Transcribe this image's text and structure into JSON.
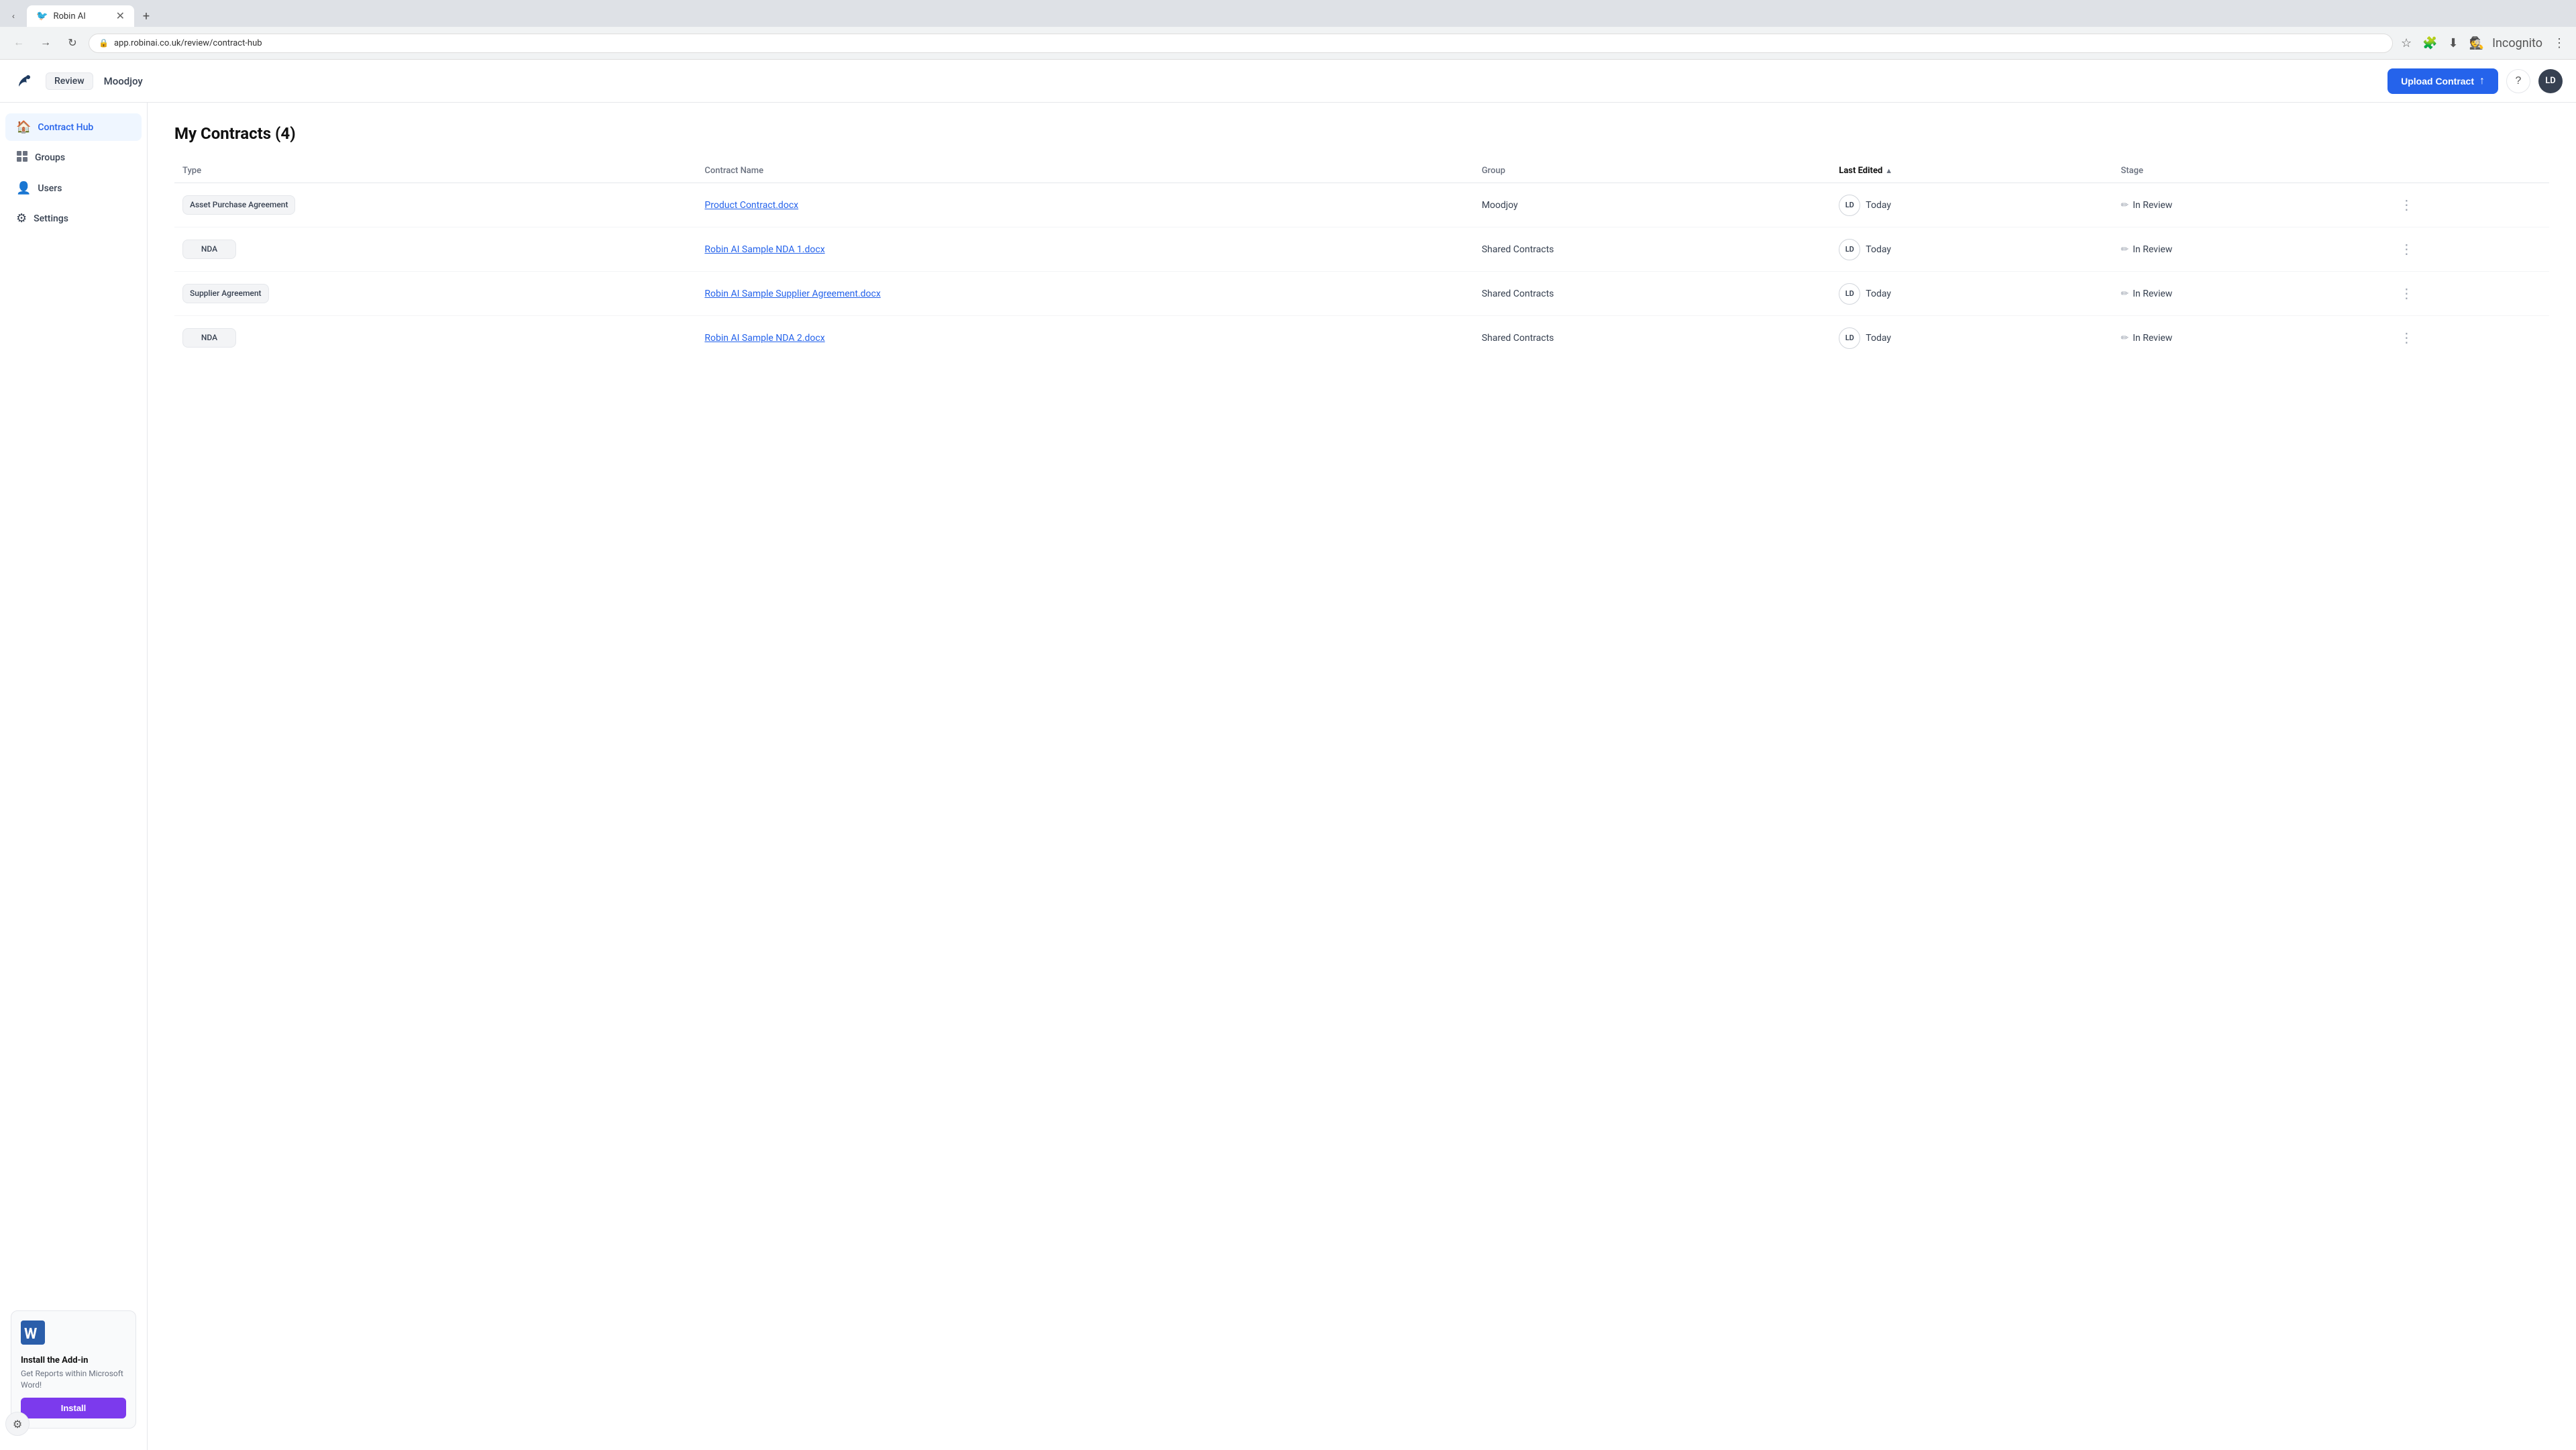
{
  "browser": {
    "tab_title": "Robin AI",
    "tab_icon": "🐦",
    "address": "app.robinai.co.uk/review/contract-hub",
    "incognito_label": "Incognito"
  },
  "header": {
    "review_label": "Review",
    "org_name": "Moodjoy",
    "upload_button": "Upload Contract",
    "help_icon": "?",
    "avatar_initials": "LD"
  },
  "sidebar": {
    "items": [
      {
        "label": "Contract Hub",
        "icon": "🏠",
        "active": true
      },
      {
        "label": "Groups",
        "icon": "⊞",
        "active": false
      },
      {
        "label": "Users",
        "icon": "👤",
        "active": false
      },
      {
        "label": "Settings",
        "icon": "⚙",
        "active": false
      }
    ],
    "addon": {
      "title": "Install the Add-in",
      "description": "Get Reports within Microsoft Word!",
      "install_label": "Install"
    }
  },
  "main": {
    "page_title": "My Contracts (4)",
    "table": {
      "columns": [
        "Type",
        "Contract Name",
        "Group",
        "Last Edited",
        "Stage"
      ],
      "rows": [
        {
          "type": "Asset Purchase Agreement",
          "contract_name": "Product Contract.docx",
          "group": "Moodjoy",
          "avatar": "LD",
          "last_edited": "Today",
          "stage": "In Review"
        },
        {
          "type": "NDA",
          "contract_name": "Robin AI Sample NDA 1.docx",
          "group": "Shared Contracts",
          "avatar": "LD",
          "last_edited": "Today",
          "stage": "In Review"
        },
        {
          "type": "Supplier Agreement",
          "contract_name": "Robin AI Sample Supplier Agreement.docx",
          "group": "Shared Contracts",
          "avatar": "LD",
          "last_edited": "Today",
          "stage": "In Review"
        },
        {
          "type": "NDA",
          "contract_name": "Robin AI Sample NDA 2.docx",
          "group": "Shared Contracts",
          "avatar": "LD",
          "last_edited": "Today",
          "stage": "In Review"
        }
      ]
    }
  }
}
